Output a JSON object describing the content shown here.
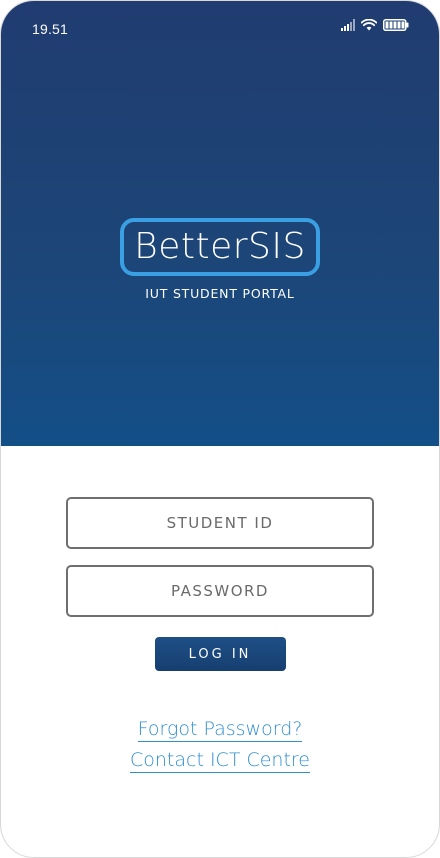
{
  "status_bar": {
    "time": "19.51",
    "icons": [
      "signal-icon",
      "wifi-icon",
      "battery-icon"
    ]
  },
  "logo": {
    "title": "BetterSIS",
    "subtitle": "IUT STUDENT PORTAL"
  },
  "login_form": {
    "student_id_placeholder": "STUDENT ID",
    "student_id_value": "",
    "password_placeholder": "PASSWORD",
    "password_value": "",
    "login_label": "LOG IN"
  },
  "links": {
    "forgot_password": "Forgot Password?",
    "contact": "Contact ICT Centre"
  },
  "colors": {
    "header_top": "#203c70",
    "header_bottom": "#134f87",
    "logo_border": "#3aa0e3",
    "link": "#2f8fd0",
    "button": "#1e4f86"
  }
}
